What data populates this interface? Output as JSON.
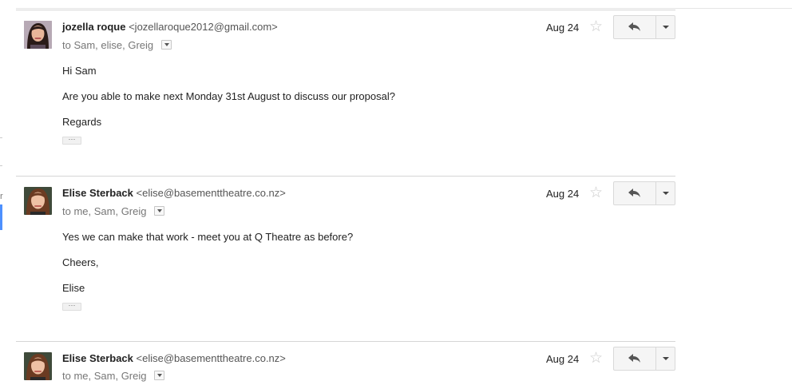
{
  "left_edge": {
    "char": "r"
  },
  "messages": [
    {
      "sender_name": "jozella roque",
      "sender_email": "<jozellaroque2012@gmail.com>",
      "recipients": "to Sam, elise, Greig",
      "date": "Aug 24",
      "avatar_icon": "person-photo-icon",
      "body": [
        "Hi Sam",
        "Are you able to make next Monday 31st August to discuss our proposal?",
        "Regards"
      ],
      "ellipsis": "···"
    },
    {
      "sender_name": "Elise Sterback",
      "sender_email": "<elise@basementtheatre.co.nz>",
      "recipients": "to me, Sam, Greig",
      "date": "Aug 24",
      "avatar_icon": "person-photo-icon",
      "body": [
        "Yes we can make that work - meet you at Q Theatre as before?",
        "Cheers,",
        "Elise"
      ],
      "ellipsis": "···"
    },
    {
      "sender_name": "Elise Sterback",
      "sender_email": "<elise@basementtheatre.co.nz>",
      "recipients": "to me, Sam, Greig",
      "date": "Aug 24",
      "avatar_icon": "person-photo-icon"
    }
  ],
  "icons": {
    "star": "star-icon",
    "reply": "reply-icon",
    "more": "chevron-down-icon"
  },
  "colors": {
    "star": "#c9c9c9",
    "divider": "#d6d6d6",
    "accent": "#4d90fe"
  }
}
